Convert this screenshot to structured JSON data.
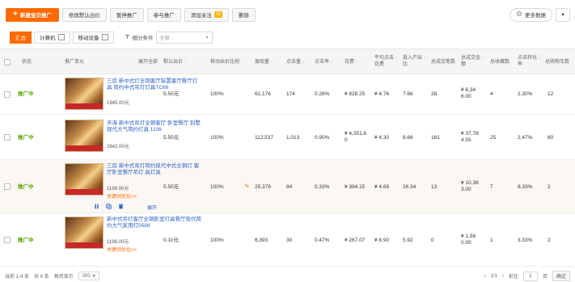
{
  "toolbar": {
    "new_label": "新建宝贝推广",
    "btn2": "修改默认出价",
    "btn3": "暂停推广",
    "btn4": "参与推广",
    "btn5": "添加关注",
    "btn5_badge": "16",
    "btn6": "删除",
    "more": "更多数据",
    "more_caret": "▾"
  },
  "tabs": {
    "t1": "汇总",
    "t2": "计算机",
    "t3": "移动设备",
    "filter_label": "细分条件",
    "select_value": "全部",
    "caret": "▾"
  },
  "columns": {
    "status": "状态",
    "product": "推广单元",
    "show_price": "展开全部",
    "default_bid": "默认出价",
    "mobile_bid": "移动出价比例",
    "impressions": "展现量",
    "clicks": "点击量",
    "ctr": "点击率",
    "cost": "花费",
    "cpc1": "平均点击",
    "cpc2": "花费",
    "roi1": "投入产出",
    "roi2": "比",
    "orders": "总成交笔数",
    "amount1": "总成交金",
    "amount2": "额",
    "fav": "总收藏数",
    "cvr1": "点击转化",
    "cvr2": "率",
    "cart": "总购物车数",
    "sort": "↕"
  },
  "rows": [
    {
      "status": "推广中",
      "name": "三房 新中式灯全铜客厅装置客厅餐厅灯具 简约中式吊灯灯具TC68",
      "price": "1945.00元",
      "default_bid": "5.50元",
      "mobile_bid": "100%",
      "impressions": "61,176",
      "clicks": "174",
      "ctr": "0.28%",
      "cost": "¥ 828.25",
      "cpc": "¥ 4.76",
      "roi": "7.66",
      "orders": "28",
      "amount_a": "¥ 6,34",
      "amount_b": "6.00",
      "fav": "4",
      "cvr": "2.30%",
      "cart": "12"
    },
    {
      "status": "推广中",
      "name": "天海 新中式吊灯全铜客厅 卧室餐厅 别墅现代大气简约灯具 1106",
      "price": "2642.00元",
      "default_bid": "5.50元",
      "mobile_bid": "100%",
      "impressions": "112,537",
      "clicks": "1,013",
      "ctr": "0.90%",
      "cost_a": "¥ 4,351.6",
      "cost_b": "0",
      "cpc": "¥ 4.30",
      "roi": "8.68",
      "orders": "161",
      "amount_a": "¥ 37,78",
      "amount_b": "4.55",
      "fav": "25",
      "cvr": "2.47%",
      "cart": "80"
    },
    {
      "status": "推广中",
      "name": "三房 新中式吊灯简约现代中式全铜灯 客厅卧室餐厅吊灯 具灯具",
      "price": "1196.00元",
      "kw": "关键词优化>>",
      "default_bid": "5.50元",
      "mobile_bid": "100%",
      "impressions": "25,379",
      "clicks": "84",
      "ctr": "0.33%",
      "cost": "¥ 394.15",
      "cpc": "¥ 4.69",
      "roi": "26.34",
      "orders": "13",
      "amount_a": "¥ 10,38",
      "amount_b": "3.00",
      "fav": "7",
      "cvr": "8.33%",
      "cart": "2",
      "op_expand": "展开"
    },
    {
      "status": "推广中",
      "name": "新中式吊灯客厅全铜卧室灯具餐厅现代简约大气家用灯0588",
      "price": "1196.00元",
      "kw": "关键词优化>>",
      "default_bid": "0.10元",
      "mobile_bid": "100%",
      "impressions": "6,393",
      "clicks": "30",
      "ctr": "0.47%",
      "cost": "¥ 267.07",
      "cpc": "¥ 8.90",
      "roi": "5.92",
      "orders": "0",
      "amount_a": "¥ 1,58",
      "amount_b": "0.00",
      "fav": "1",
      "cvr": "3.33%",
      "cart": "2"
    }
  ],
  "footer": {
    "range": "当前 1-4 条",
    "total": "共 4 条",
    "per_page_label": "每页显示",
    "per_page": "200",
    "caret": "▾",
    "page_info": "1/1",
    "jump_label": "前往",
    "page_input": "1",
    "page_unit": "页",
    "go": "确定"
  }
}
